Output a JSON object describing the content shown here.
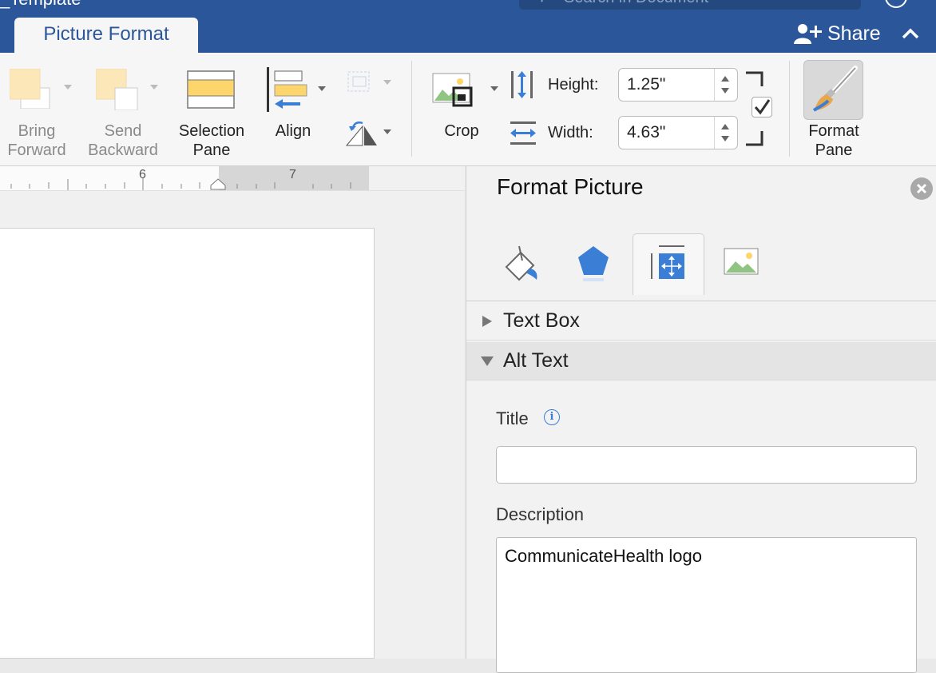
{
  "window": {
    "doc_title": "_Template",
    "search_placeholder": "Search in Document"
  },
  "tabs": {
    "active": "Picture Format"
  },
  "share": {
    "label": "Share"
  },
  "ribbon": {
    "bring_forward": [
      "Bring",
      "Forward"
    ],
    "send_backward": [
      "Send",
      "Backward"
    ],
    "selection_pane": [
      "Selection",
      "Pane"
    ],
    "align": "Align",
    "crop": "Crop",
    "height_label": "Height:",
    "height_value": "1.25\"",
    "width_label": "Width:",
    "width_value": "4.63\"",
    "lock_aspect_checked": true,
    "format_pane": [
      "Format",
      "Pane"
    ]
  },
  "ruler": {
    "numbers": [
      "6",
      "7"
    ]
  },
  "format_pane": {
    "title": "Format Picture",
    "tabs": [
      "fill-line-icon",
      "effects-icon",
      "size-properties-icon",
      "picture-icon"
    ],
    "active_tab": "size-properties-icon",
    "sections": {
      "text_box": "Text Box",
      "alt_text": "Alt Text"
    },
    "alt_text": {
      "title_label": "Title",
      "title_value": "",
      "description_label": "Description",
      "description_value": "CommunicateHealth logo"
    }
  },
  "colors": {
    "brand_blue": "#2b579a",
    "ribbon_bg": "#f6f6f6",
    "pane_bg": "#f2f2f2"
  }
}
